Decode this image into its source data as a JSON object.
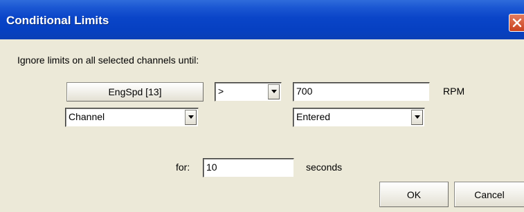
{
  "window": {
    "title": "Conditional Limits"
  },
  "dialog": {
    "instruction": "Ignore limits on all selected channels until:",
    "channel_button_label": "EngSpd [13]",
    "operator_value": ">",
    "threshold_value": "700",
    "unit_label": "RPM",
    "source_left_value": "Channel",
    "source_right_value": "Entered",
    "for_label": "for:",
    "duration_value": "10",
    "duration_unit_label": "seconds",
    "ok_label": "OK",
    "cancel_label": "Cancel"
  }
}
